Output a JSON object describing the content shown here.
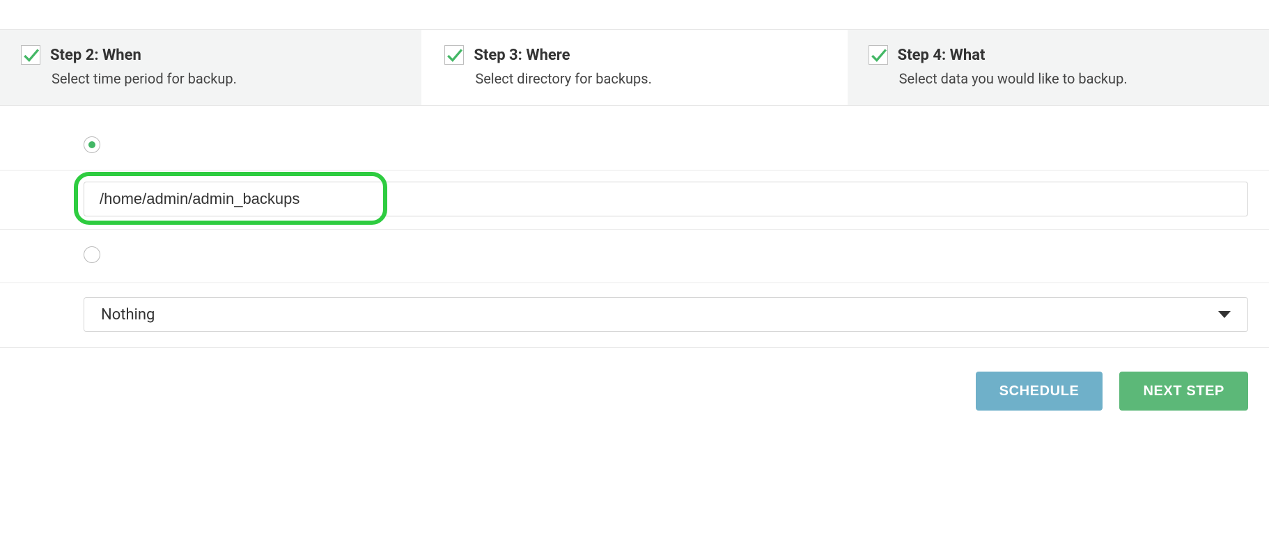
{
  "steps": [
    {
      "title": "Step 2: When",
      "desc": "Select time period for backup.",
      "checked": true,
      "active": false
    },
    {
      "title": "Step 3: Where",
      "desc": "Select directory for backups.",
      "checked": true,
      "active": true
    },
    {
      "title": "Step 4: What",
      "desc": "Select data you would like to backup.",
      "checked": true,
      "active": false
    }
  ],
  "form": {
    "location_option_selected": 0,
    "path_value": "/home/admin/admin_backups",
    "select_value": "Nothing"
  },
  "buttons": {
    "schedule": "SCHEDULE",
    "next": "NEXT STEP"
  },
  "colors": {
    "accent_green": "#43b765",
    "highlight_green": "#2ecc40",
    "btn_blue": "#6fb0c9",
    "btn_green": "#5cb878"
  }
}
